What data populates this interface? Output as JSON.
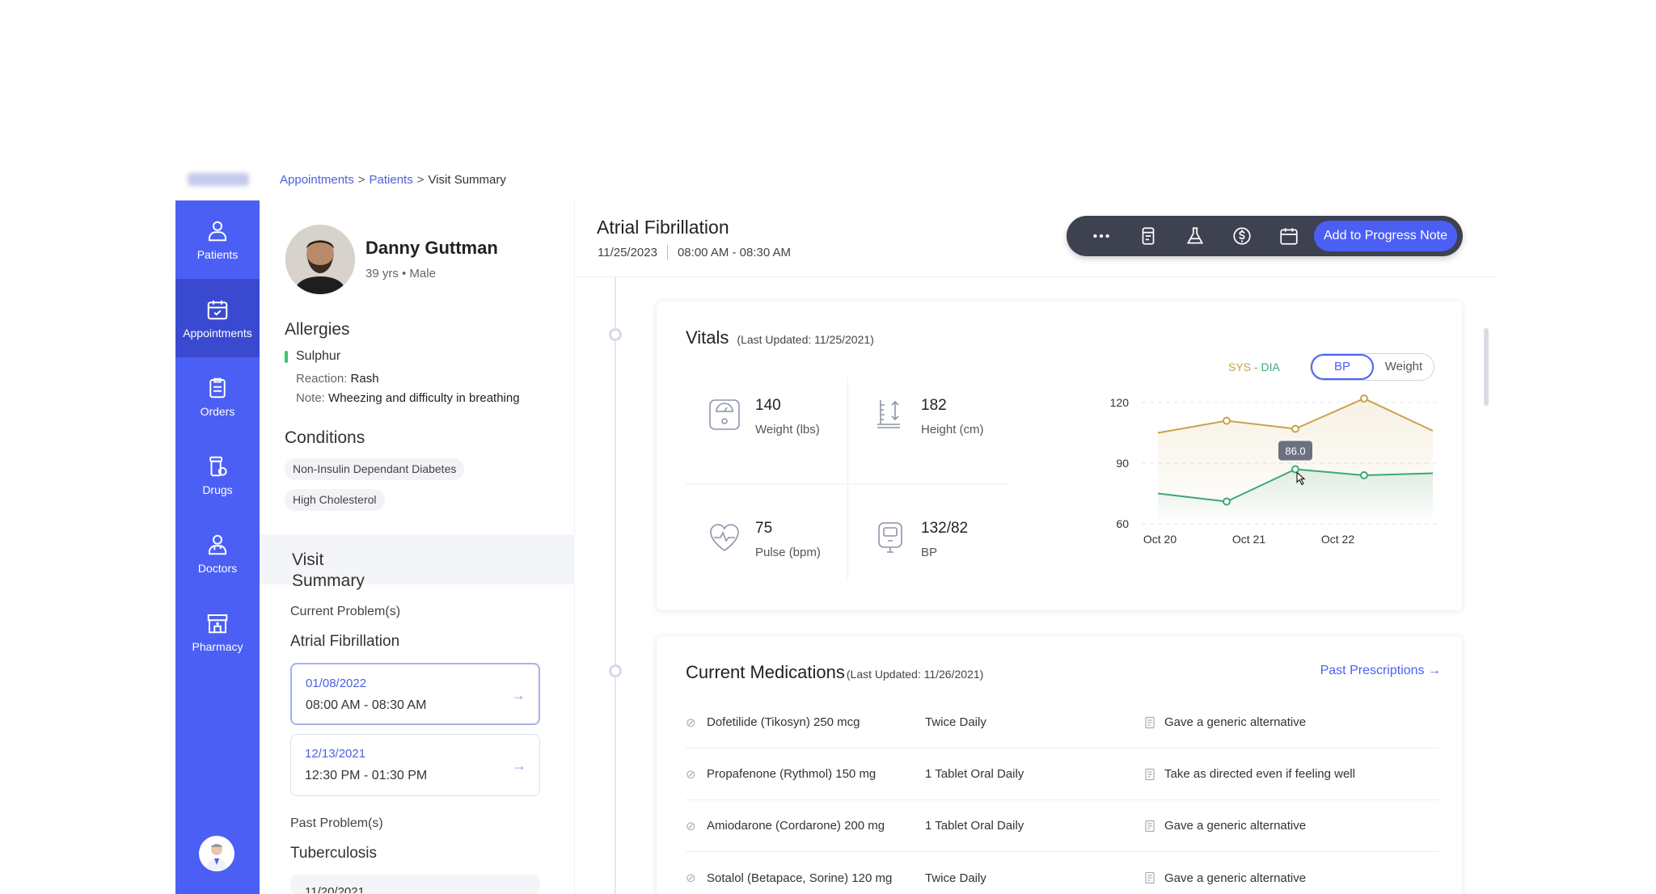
{
  "breadcrumb": {
    "item1": "Appointments",
    "item2": "Patients",
    "current": "Visit Summary",
    "sep": ">"
  },
  "nav": {
    "items": [
      {
        "label": "Patients"
      },
      {
        "label": "Appointments"
      },
      {
        "label": "Orders"
      },
      {
        "label": "Drugs"
      },
      {
        "label": "Doctors"
      },
      {
        "label": "Pharmacy"
      }
    ]
  },
  "patient": {
    "name": "Danny Guttman",
    "meta": "39 yrs • Male",
    "allergies_title": "Allergies",
    "allergy_name": "Sulphur",
    "reaction_label": "Reaction:",
    "reaction_value": "Rash",
    "note_label": "Note:",
    "note_value": "Wheezing and difficulty in breathing",
    "conditions_title": "Conditions",
    "conditions": [
      "Non-Insulin Dependant Diabetes",
      "High Cholesterol"
    ]
  },
  "visit_summary": {
    "title_line1": "Visit",
    "title_line2": "Summary",
    "current_label": "Current Problem(s)",
    "current_problem": "Atrial Fibrillation",
    "visits": [
      {
        "date": "01/08/2022",
        "time": "08:00 AM - 08:30 AM"
      },
      {
        "date": "12/13/2021",
        "time": "12:30 PM - 01:30 PM"
      }
    ],
    "past_label": "Past Problem(s)",
    "past_problem": "Tuberculosis",
    "past_visit_date": "11/20/2021"
  },
  "encounter": {
    "title": "Atrial Fibrillation",
    "date": "11/25/2023",
    "time": "08:00 AM - 08:30 AM",
    "action_label": "Add to Progress Note"
  },
  "vitals": {
    "title": "Vitals",
    "updated": "(Last Updated: 11/25/2021)",
    "weight_value": "140",
    "weight_label": "Weight (lbs)",
    "height_value": "182",
    "height_label": "Height (cm)",
    "pulse_value": "75",
    "pulse_label": "Pulse (bpm)",
    "bp_value": "132/82",
    "bp_label": "BP",
    "legend_sys": "SYS",
    "legend_sep": " - ",
    "legend_dia": "DIA",
    "toggle_bp": "BP",
    "toggle_weight": "Weight",
    "tooltip": "86.0"
  },
  "chart_data": {
    "type": "line",
    "x_ticks": [
      "Oct 20",
      "Oct 21",
      "Oct 22"
    ],
    "y_ticks": [
      60,
      90,
      120
    ],
    "ylim": [
      60,
      120
    ],
    "series": [
      {
        "name": "SYS",
        "color": "#c9a24a",
        "values": [
          105,
          111,
          107,
          122,
          106
        ]
      },
      {
        "name": "DIA",
        "color": "#3aa876",
        "values": [
          75,
          71,
          87,
          84,
          85
        ]
      }
    ],
    "point_x": [
      0,
      1,
      2,
      3,
      4
    ]
  },
  "medications": {
    "title": "Current Medications",
    "updated": "(Last Updated: 11/26/2021)",
    "past_link": "Past Prescriptions →",
    "rows": [
      {
        "name": "Dofetilide (Tikosyn) 250 mcg",
        "freq": "Twice Daily",
        "note": "Gave a generic alternative"
      },
      {
        "name": "Propafenone (Rythmol) 150 mg",
        "freq": "1 Tablet Oral Daily",
        "note": "Take as directed even if feeling well"
      },
      {
        "name": "Amiodarone (Cordarone) 200 mg",
        "freq": "1 Tablet Oral Daily",
        "note": "Gave a generic alternative"
      },
      {
        "name": "Sotalol (Betapace, Sorine) 120 mg",
        "freq": "Twice Daily",
        "note": "Gave a generic alternative"
      }
    ]
  }
}
